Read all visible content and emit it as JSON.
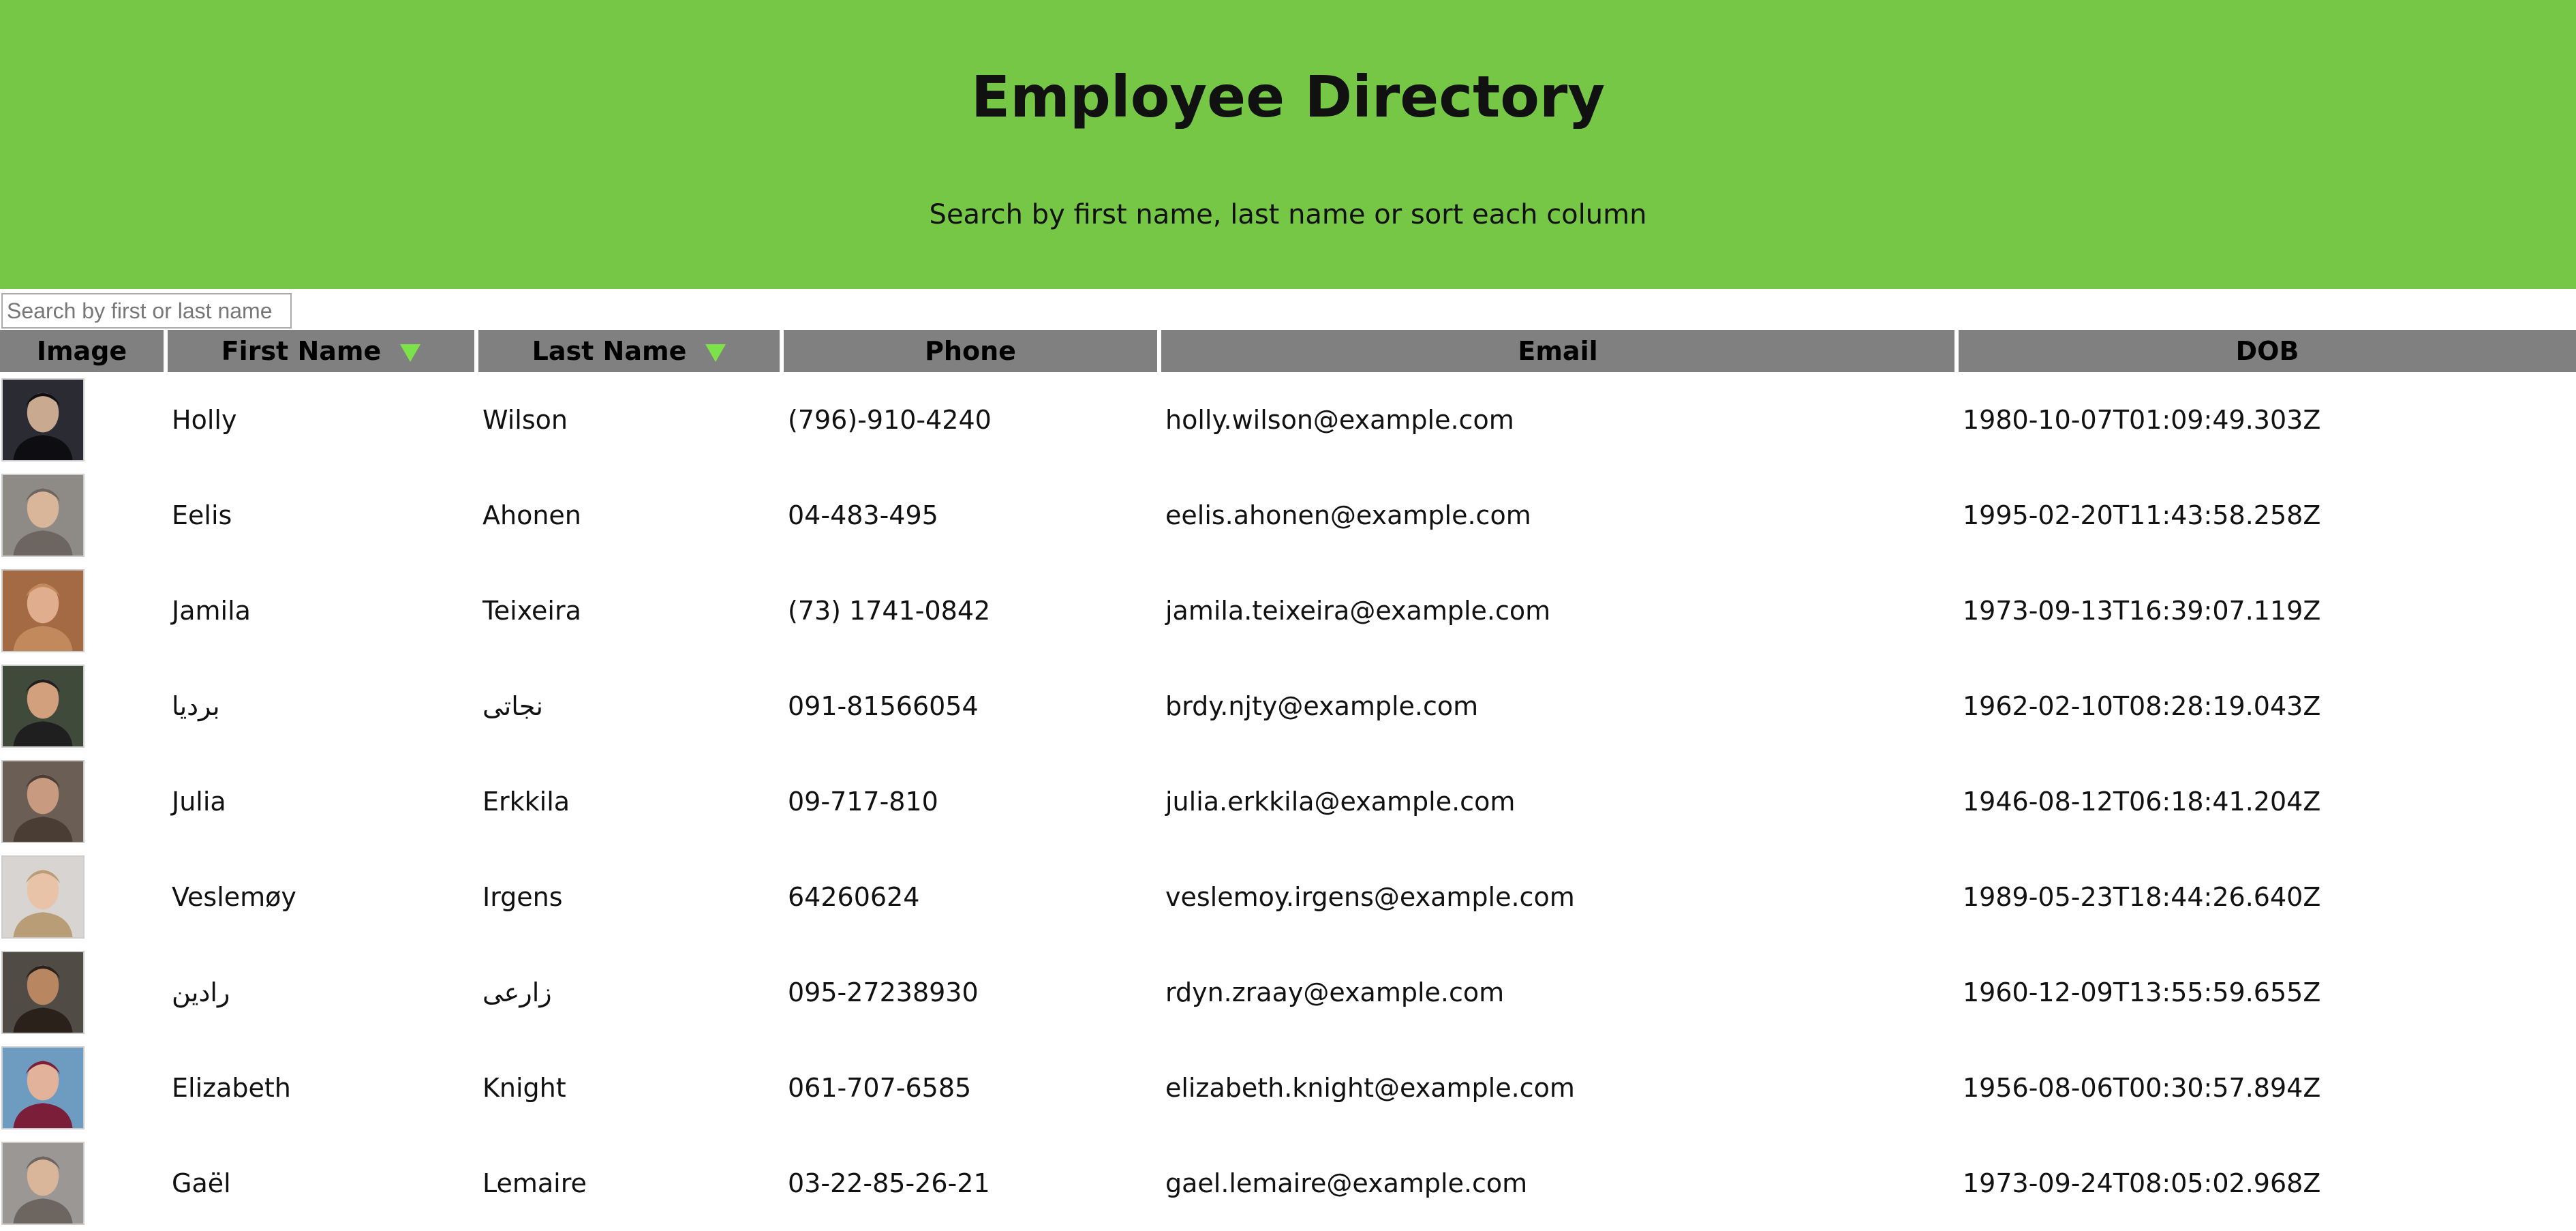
{
  "header": {
    "title": "Employee Directory",
    "subtitle": "Search by first name, last name or sort each column"
  },
  "search": {
    "placeholder": "Search by first or last name",
    "value": ""
  },
  "table": {
    "columns": [
      "Image",
      "First Name",
      "Last Name",
      "Phone",
      "Email",
      "DOB"
    ],
    "sorted_columns": [
      "First Name",
      "Last Name"
    ],
    "sort_arrow_color": "#7ce24a",
    "rows": [
      {
        "first": "Holly",
        "last": "Wilson",
        "phone": "(796)-910-4240",
        "email": "holly.wilson@example.com",
        "dob": "1980-10-07T01:09:49.303Z"
      },
      {
        "first": "Eelis",
        "last": "Ahonen",
        "phone": "04-483-495",
        "email": "eelis.ahonen@example.com",
        "dob": "1995-02-20T11:43:58.258Z"
      },
      {
        "first": "Jamila",
        "last": "Teixeira",
        "phone": "(73) 1741-0842",
        "email": "jamila.teixeira@example.com",
        "dob": "1973-09-13T16:39:07.119Z"
      },
      {
        "first": "بردیا",
        "last": "نجاتی",
        "phone": "091-81566054",
        "email": "brdy.njty@example.com",
        "dob": "1962-02-10T08:28:19.043Z"
      },
      {
        "first": "Julia",
        "last": "Erkkila",
        "phone": "09-717-810",
        "email": "julia.erkkila@example.com",
        "dob": "1946-08-12T06:18:41.204Z"
      },
      {
        "first": "Veslemøy",
        "last": "Irgens",
        "phone": "64260624",
        "email": "veslemoy.irgens@example.com",
        "dob": "1989-05-23T18:44:26.640Z"
      },
      {
        "first": "رادین",
        "last": "زارعی",
        "phone": "095-27238930",
        "email": "rdyn.zraay@example.com",
        "dob": "1960-12-09T13:55:59.655Z"
      },
      {
        "first": "Elizabeth",
        "last": "Knight",
        "phone": "061-707-6585",
        "email": "elizabeth.knight@example.com",
        "dob": "1956-08-06T00:30:57.894Z"
      },
      {
        "first": "Gaël",
        "last": "Lemaire",
        "phone": "03-22-85-26-21",
        "email": "gael.lemaire@example.com",
        "dob": "1973-09-24T08:05:02.968Z"
      }
    ]
  },
  "colors": {
    "header_bg": "#76c746",
    "table_header_bg": "#808080"
  }
}
